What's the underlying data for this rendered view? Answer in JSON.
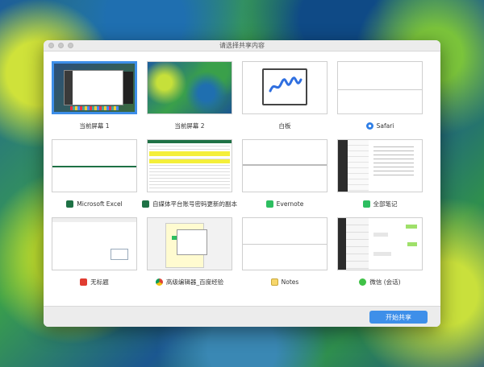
{
  "window": {
    "title": "请选择共享内容"
  },
  "items": [
    {
      "label": "当前屏幕 1",
      "icon": "",
      "selected": true
    },
    {
      "label": "当前屏幕 2",
      "icon": ""
    },
    {
      "label": "白板",
      "icon": ""
    },
    {
      "label": "Safari",
      "icon": "safari-icon"
    },
    {
      "label": "Microsoft Excel",
      "icon": "excel-icon"
    },
    {
      "label": "自媒体平台账号密码更新的副本",
      "icon": "excel-icon"
    },
    {
      "label": "Evernote",
      "icon": "evernote-icon"
    },
    {
      "label": "全部笔记",
      "icon": "evernote-icon"
    },
    {
      "label": "无标题",
      "icon": "pdf-icon"
    },
    {
      "label": "高级编辑器_百度经验",
      "icon": "chrome-icon"
    },
    {
      "label": "Notes",
      "icon": "notes-icon"
    },
    {
      "label": "微信 (会话)",
      "icon": "wechat-icon"
    }
  ],
  "footer": {
    "start_label": "开始共享"
  },
  "colors": {
    "accent": "#3e8fe9",
    "selected_border": "#3d8ee8"
  }
}
